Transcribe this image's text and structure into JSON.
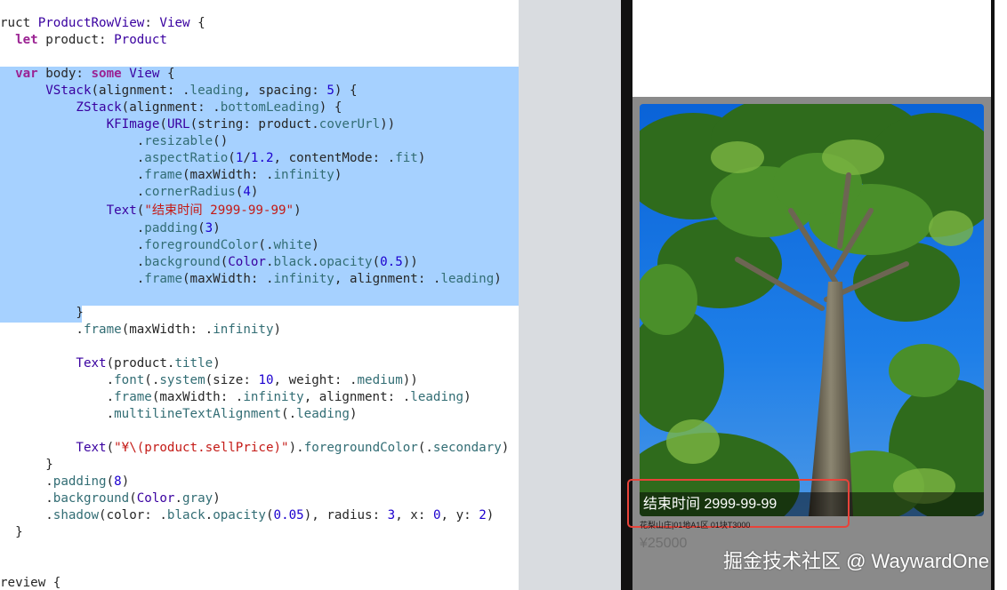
{
  "code": {
    "lines": [
      "ruct ProductRowView: View {",
      "  let product: Product",
      "",
      "  var body: some View {",
      "      VStack(alignment: .leading, spacing: 5) {",
      "          ZStack(alignment: .bottomLeading) {",
      "              KFImage(URL(string: product.coverUrl))",
      "                  .resizable()",
      "                  .aspectRatio(1/1.2, contentMode: .fit)",
      "                  .frame(maxWidth: .infinity)",
      "                  .cornerRadius(4)",
      "              Text(\"结束时间 2999-99-99\")",
      "                  .padding(3)",
      "                  .foregroundColor(.white)",
      "                  .background(Color.black.opacity(0.5))",
      "                  .frame(maxWidth: .infinity, alignment: .leading)",
      "",
      "          }",
      "          .frame(maxWidth: .infinity)",
      "",
      "          Text(product.title)",
      "              .font(.system(size: 10, weight: .medium))",
      "              .frame(maxWidth: .infinity, alignment: .leading)",
      "              .multilineTextAlignment(.leading)",
      "",
      "          Text(\"¥\\(product.sellPrice)\").foregroundColor(.secondary)",
      "      }",
      "      .padding(8)",
      "      .background(Color.gray)",
      "      .shadow(color: .black.opacity(0.05), radius: 3, x: 0, y: 2)",
      "  }",
      "",
      "",
      "review {"
    ]
  },
  "preview": {
    "caption": "结束时间 2999-99-99",
    "title": "花梨山庄|01地A1区 01块T3000",
    "price": "¥25000",
    "watermark": "掘金技术社区 @ WaywardOne"
  },
  "colors": {
    "selection": "#a6d1ff",
    "keyword": "#9b2393",
    "highlight_box": "#e8433a",
    "card_background": "#8a8a8a"
  }
}
